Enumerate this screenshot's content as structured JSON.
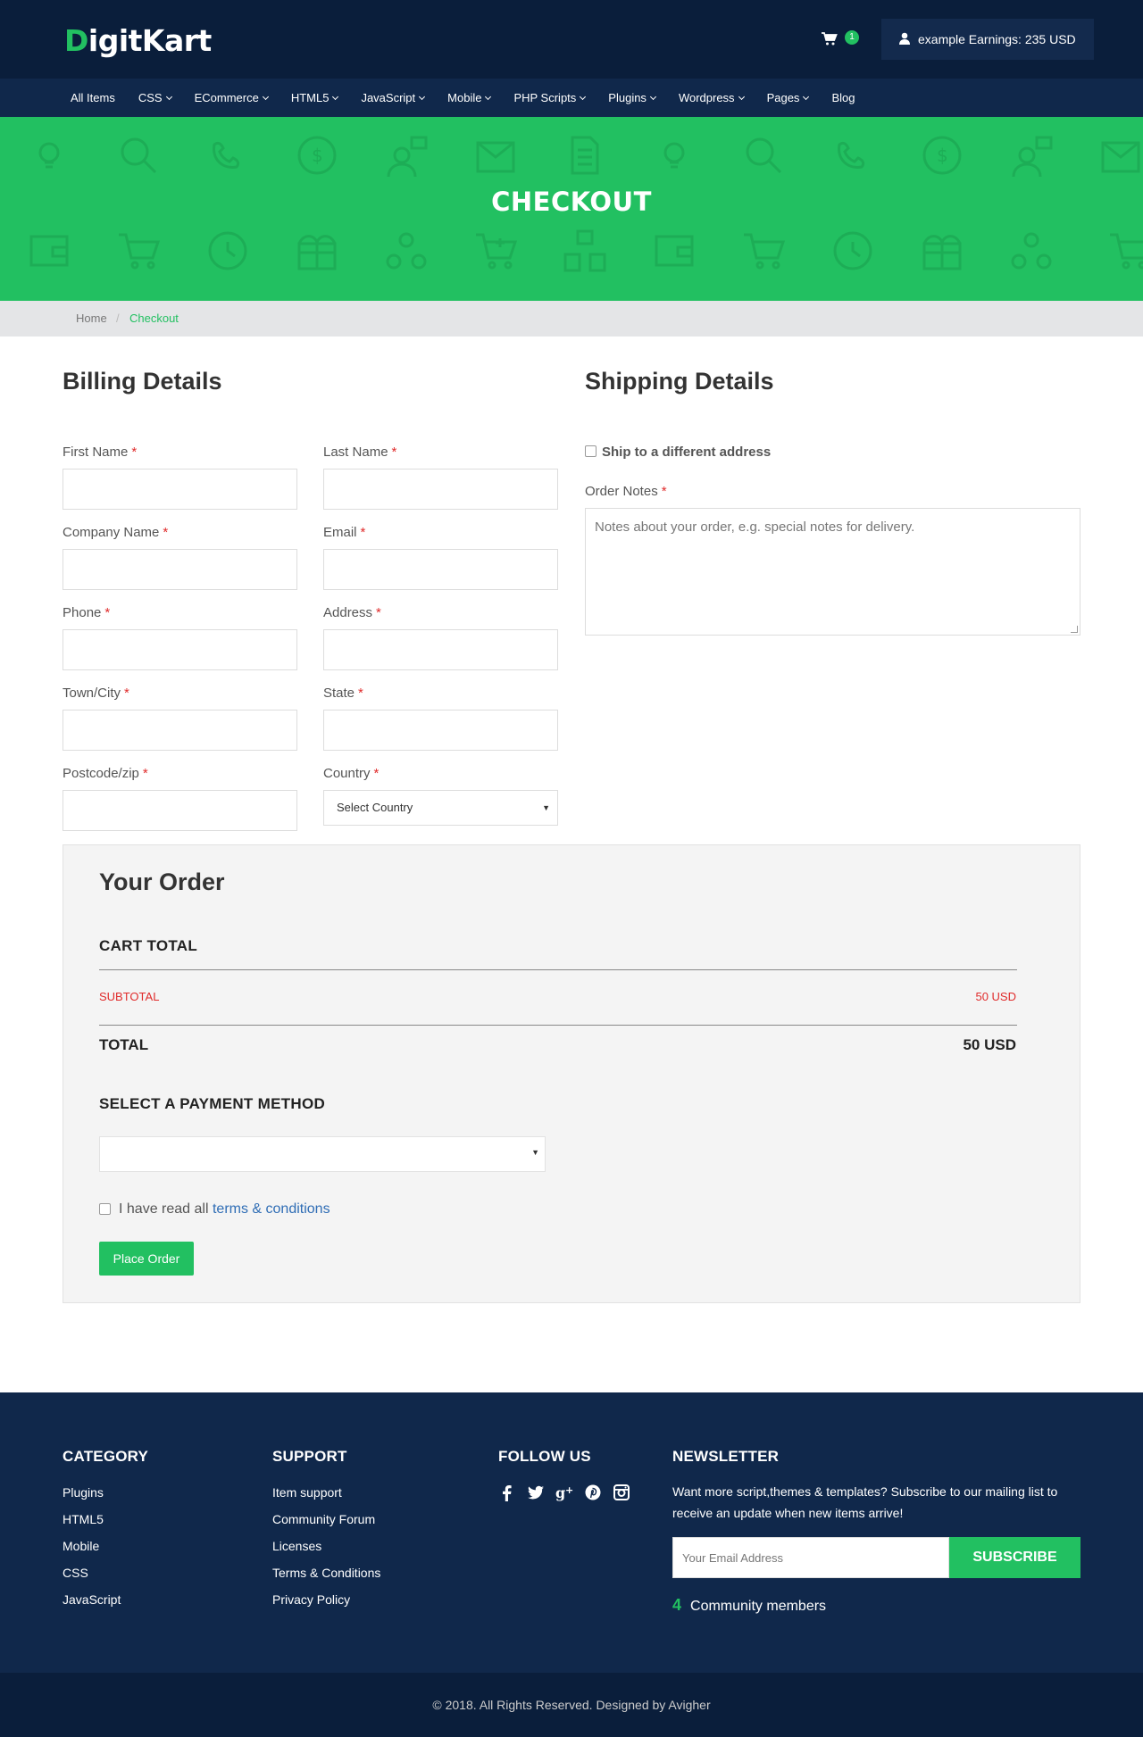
{
  "brand": {
    "first_letter": "D",
    "rest": "igitKart",
    "accent": "#22c061"
  },
  "header": {
    "cart_icon": "shopping-cart-icon",
    "cart_count": "1",
    "account_icon": "user-icon",
    "account_text": "example Earnings: 235 USD"
  },
  "nav": [
    {
      "label": "All Items",
      "dropdown": false
    },
    {
      "label": "CSS",
      "dropdown": true
    },
    {
      "label": "ECommerce",
      "dropdown": true
    },
    {
      "label": "HTML5",
      "dropdown": true
    },
    {
      "label": "JavaScript",
      "dropdown": true
    },
    {
      "label": "Mobile",
      "dropdown": true
    },
    {
      "label": "PHP Scripts",
      "dropdown": true
    },
    {
      "label": "Plugins",
      "dropdown": true
    },
    {
      "label": "Wordpress",
      "dropdown": true
    },
    {
      "label": "Pages",
      "dropdown": true
    },
    {
      "label": "Blog",
      "dropdown": false
    }
  ],
  "hero": {
    "title": "CHECKOUT"
  },
  "breadcrumb": {
    "home": "Home",
    "separator": "/",
    "current": "Checkout"
  },
  "billing": {
    "title": "Billing Details",
    "required_mark": "*",
    "fields": {
      "first_name": "First Name",
      "last_name": "Last Name",
      "company": "Company Name",
      "email": "Email",
      "phone": "Phone",
      "address": "Address",
      "city": "Town/City",
      "state": "State",
      "postcode": "Postcode/zip",
      "country": "Country"
    },
    "country_selected": "Select Country"
  },
  "shipping": {
    "title": "Shipping Details",
    "different_address_label": "Ship to a different address",
    "notes_label": "Order Notes",
    "notes_placeholder": "Notes about your order, e.g. special notes for delivery."
  },
  "order": {
    "title": "Your Order",
    "cart_total_heading": "CART TOTAL",
    "subtotal_label": "SUBTOTAL",
    "subtotal_value": "50 USD",
    "total_label": "TOTAL",
    "total_value": "50 USD",
    "payment_heading": "SELECT A PAYMENT METHOD",
    "payment_selected": "",
    "terms_prefix": "I have read all",
    "terms_link": "terms & conditions",
    "place_order": "Place Order"
  },
  "footer": {
    "category": {
      "title": "CATEGORY",
      "items": [
        "Plugins",
        "HTML5",
        "Mobile",
        "CSS",
        "JavaScript"
      ]
    },
    "support": {
      "title": "SUPPORT",
      "items": [
        "Item support",
        "Community Forum",
        "Licenses",
        "Terms & Conditions",
        "Privacy Policy"
      ]
    },
    "follow": {
      "title": "FOLLOW US",
      "icons": [
        "facebook-icon",
        "twitter-icon",
        "google-plus-icon",
        "pinterest-icon",
        "instagram-icon"
      ]
    },
    "newsletter": {
      "title": "NEWSLETTER",
      "text": "Want more script,themes & templates? Subscribe to our mailing list to receive an update when new items arrive!",
      "placeholder": "Your Email Address",
      "button": "SUBSCRIBE",
      "members_count": "4",
      "members_label": "Community members"
    },
    "copyright": "© 2018. All Rights Reserved. Designed by Avigher"
  },
  "colors": {
    "navy_dark": "#0a1e3b",
    "navy": "#10284b",
    "green": "#22c061",
    "required": "#e02b2b",
    "link": "#2f6db5"
  }
}
